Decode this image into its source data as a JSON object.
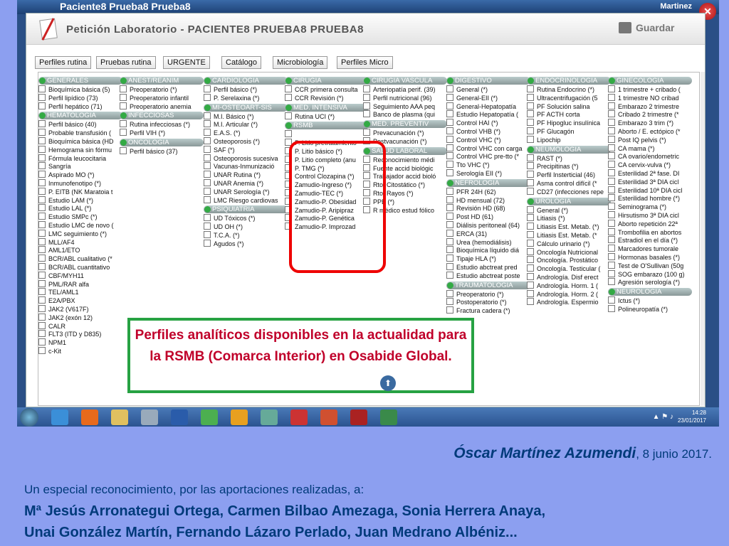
{
  "window": {
    "app_title": "Paciente8 Prueba8 Prueba8",
    "user": "Martinez",
    "dialog_title": "Petición Laboratorio - PACIENTE8 PRUEBA8 PRUEBA8",
    "save_label": "Guardar"
  },
  "tabs": [
    "Perfiles rutina",
    "Pruebas rutina",
    "URGENTE",
    "Catálogo",
    "Microbiología",
    "Perfiles Micro"
  ],
  "columns": [
    {
      "sections": [
        {
          "title": "GENERALES",
          "items": [
            "Bioquímica básica (5)",
            "Perfil lipídico (73)",
            "Perfil hepático (71)"
          ]
        },
        {
          "title": "HEMATOLOGIA",
          "items": [
            "Perfil básico (40)",
            "Probable transfusión (",
            "Bioquímica básica (HD",
            "Hemograma sin fórmu",
            "Fórmula leucocitaria",
            "Sangría",
            "Aspirado MO (*)",
            "Inmunofenotipo (*)",
            "P. EITB (NK Maratoia t",
            "Estudio LAM (*)",
            "Estudio LAL (*)",
            "Estudio SMPc (*)",
            "Estudio LMC de novo (",
            "LMC seguimiento (*)",
            "MLL/AF4",
            "AML1/ETO",
            "BCR/ABL cualitativo (*",
            "BCR/ABL cuantitativo",
            "CBF/MYH11",
            "PML/RAR alfa",
            "TEL/AML1",
            "E2A/PBX",
            "JAK2 (V617F)",
            "JAK2 (exón 12)",
            "CALR",
            "FLT3 (ITD y D835)",
            "NPM1",
            "c-Kit"
          ]
        }
      ]
    },
    {
      "sections": [
        {
          "title": "ANEST/REANIM",
          "items": [
            "Preoperatorio (*)",
            "Preoperatorio infantil",
            "Preoperatorio anemia"
          ]
        },
        {
          "title": "INFECCIOSAS",
          "items": [
            "Rutina infecciosas (*)",
            "Perfil VIH (*)"
          ]
        },
        {
          "title": "ONCOLOGIA",
          "items": [
            "Perfil básico (37)"
          ]
        }
      ]
    },
    {
      "sections": [
        {
          "title": "CARDIOLOGIA",
          "items": [
            "Perfil básico (*)",
            "P. Serelaxina (*)"
          ]
        },
        {
          "title": "MI-OSTEOART-SIS",
          "items": [
            "M.I. Básico (*)",
            "M.I. Articular (*)",
            "E.A.S. (*)",
            "Osteoporosis (*)",
            "SAF (*)",
            "Osteoporosis sucesiva",
            "Vacunas-Inmunizació",
            "UNAR Rutina (*)",
            "UNAR Anemia (*)",
            "UNAR Serología (*)",
            "LMC Riesgo cardiovas"
          ]
        },
        {
          "title": "PSIQUIATRIA",
          "items": [
            "UD Tóxicos (*)",
            "UD OH (*)",
            "T.C.A. (*)",
            "Agudos (*)"
          ]
        }
      ]
    },
    {
      "sections": [
        {
          "title": "CIRUGIA",
          "items": [
            "CCR primera consulta",
            "CCR Revisión (*)"
          ]
        },
        {
          "title": "MED. INTENSIVA",
          "items": [
            "Rutina UCI (*)"
          ]
        },
        {
          "title": "RSMB",
          "items": [
            "",
            "P. Litio pretratamiento",
            "P. Litio básico (*)",
            "P. Litio completo (anu",
            "P. TMG (*)",
            "Control Clozapina (*)",
            "Zamudio-Ingreso (*)",
            "Zamudio-TEC (*)",
            "Zamudio-P. Obesidad",
            "Zamudio-P. Aripipraz",
            "Zamudio-P. Genética",
            "Zamudio-P. Improzad"
          ]
        }
      ]
    },
    {
      "sections": [
        {
          "title": "CIRUGIA VASCULA",
          "items": [
            "Arteriopatía perif. (39)",
            "Perfil nutricional (96)",
            "Seguimiento AAA peq",
            "Banco de plasma (qui"
          ]
        },
        {
          "title": "MED. PREVENTIV",
          "items": [
            "Prevacunación (*)",
            "Postvacunación (*)"
          ]
        },
        {
          "title": "SALUD LABORAL",
          "items": [
            "Reconocimiento médi",
            "Fuente accid biológic",
            "Trabajador accid bioló",
            "Rto. Citostático (*)",
            "Rto. Rayos (*)",
            "PPE (*)",
            "R médico estud fólico"
          ]
        }
      ]
    },
    {
      "sections": [
        {
          "title": "DIGESTIVO",
          "items": [
            "General (*)",
            "General-EII (*)",
            "General-Hepatopatía",
            "Estudio Hepatopatía (",
            "Control HAI (*)",
            "Control VHB (*)",
            "Control VHC (*)",
            "Control VHC con carga",
            "Control VHC pre-tto (*",
            "Tto VHC (*)",
            "Serología EII (*)"
          ]
        },
        {
          "title": "NEFROLOGIA",
          "items": [
            "PFR 24H (62)",
            "HD mensual (72)",
            "Revisión HD (68)",
            "Post HD (61)",
            "Diálisis peritoneal (64)",
            "ERCA (31)",
            "Urea (hemodiálisis)",
            "Bioquímica líquido diá",
            "Tipaje HLA (*)",
            "Estudio abctreat pred",
            "Estudio abctreat poste"
          ]
        },
        {
          "title": "TRAUMATOLOGIA",
          "items": [
            "Preoperatorio (*)",
            "Postoperatorio (*)",
            "Fractura cadera (*)"
          ]
        }
      ]
    },
    {
      "sections": [
        {
          "title": "ENDOCRINOLOGIA",
          "items": [
            "Rutina Endocrino (*)",
            "Ultracentrifugación (5",
            "PF Solución salina",
            "PF ACTH corta",
            "PF Hipogluc insulínica",
            "PF Glucagón",
            "Lipochip"
          ]
        },
        {
          "title": "NEUMOLOGIA",
          "items": [
            "RAST (*)",
            "Precipitinas (*)",
            "Perfil Insterticial (46)",
            "Asma control difícil (*",
            "CD27 (infecciones repe"
          ]
        },
        {
          "title": "UROLOGIA",
          "items": [
            "General (*)",
            "Litiasis (*)",
            "Litiasis Est. Metab. (*)",
            "Litiasis Est. Metab. (*",
            "Cálculo urinario (*)",
            "Oncología Nutricional",
            "Oncología. Prostático",
            "Oncología. Testicular (",
            "Andrología. Disf erect",
            "Andrología. Horm. 1 (",
            "Andrología. Horm. 2 (",
            "Andrología. Espermio"
          ]
        }
      ]
    },
    {
      "sections": [
        {
          "title": "GINECOLOGIA",
          "items": [
            "1 trimestre + cribado (",
            "1 trimestre NO cribad",
            "Embarazo 2 trimestre",
            "Cribado 2 trimestre (*",
            "Embarazo 3 trim (*)",
            "Aborto / E. ectópico (*",
            "Post IQ pelvis (*)",
            "CA mama (*)",
            "CA ovario/endometric",
            "CA cervix-vulva (*)",
            "Esterilidad 2ª fase. DI",
            "Esterilidad 3ª DIA cicl",
            "Esterilidad 10ª DIA cicl",
            "Esterilidad hombre (*)",
            "Seminograma (*)",
            "Hirsutismo 3ª DIA cicl",
            "Aborto repetición 22ª",
            "Trombofilia en abortos",
            "Estradiol en el día (*)",
            "Marcadores tumorale",
            "Hormonas basales (*)",
            "Test de O'Sullivan (50g",
            "SOG embarazo (100 g)",
            "Agresión serología (*)"
          ]
        },
        {
          "title": "NEUROLOGIA",
          "items": [
            "Ictus (*)",
            "Polineuropatía (*)"
          ]
        }
      ]
    }
  ],
  "callout": "Perfiles analíticos disponibles en la actualidad para la RSMB (Comarca Interior) en Osabide Global.",
  "taskbar": {
    "time": "14:28",
    "date": "23/01/2017"
  },
  "author": {
    "name": "Óscar Martínez Azumendi",
    "date": ", 8 junio 2017."
  },
  "acknowledgement": "Un especial reconocimiento, por las aportaciones realizadas, a:",
  "names_line1": "Mª Jesús Arronategui Ortega, Carmen Bilbao Amezaga, Sonia Herrera Anaya,",
  "names_line2": "Unai González Martín, Fernando Lázaro Perlado, Juan Medrano Albéniz..."
}
